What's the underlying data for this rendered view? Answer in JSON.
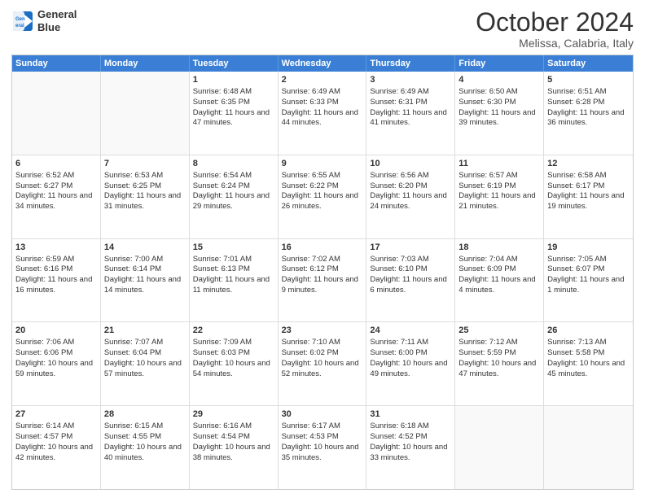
{
  "header": {
    "logo_line1": "General",
    "logo_line2": "Blue",
    "month": "October 2024",
    "location": "Melissa, Calabria, Italy"
  },
  "weekdays": [
    "Sunday",
    "Monday",
    "Tuesday",
    "Wednesday",
    "Thursday",
    "Friday",
    "Saturday"
  ],
  "rows": [
    [
      {
        "day": "",
        "content": ""
      },
      {
        "day": "",
        "content": ""
      },
      {
        "day": "1",
        "content": "Sunrise: 6:48 AM\nSunset: 6:35 PM\nDaylight: 11 hours and 47 minutes."
      },
      {
        "day": "2",
        "content": "Sunrise: 6:49 AM\nSunset: 6:33 PM\nDaylight: 11 hours and 44 minutes."
      },
      {
        "day": "3",
        "content": "Sunrise: 6:49 AM\nSunset: 6:31 PM\nDaylight: 11 hours and 41 minutes."
      },
      {
        "day": "4",
        "content": "Sunrise: 6:50 AM\nSunset: 6:30 PM\nDaylight: 11 hours and 39 minutes."
      },
      {
        "day": "5",
        "content": "Sunrise: 6:51 AM\nSunset: 6:28 PM\nDaylight: 11 hours and 36 minutes."
      }
    ],
    [
      {
        "day": "6",
        "content": "Sunrise: 6:52 AM\nSunset: 6:27 PM\nDaylight: 11 hours and 34 minutes."
      },
      {
        "day": "7",
        "content": "Sunrise: 6:53 AM\nSunset: 6:25 PM\nDaylight: 11 hours and 31 minutes."
      },
      {
        "day": "8",
        "content": "Sunrise: 6:54 AM\nSunset: 6:24 PM\nDaylight: 11 hours and 29 minutes."
      },
      {
        "day": "9",
        "content": "Sunrise: 6:55 AM\nSunset: 6:22 PM\nDaylight: 11 hours and 26 minutes."
      },
      {
        "day": "10",
        "content": "Sunrise: 6:56 AM\nSunset: 6:20 PM\nDaylight: 11 hours and 24 minutes."
      },
      {
        "day": "11",
        "content": "Sunrise: 6:57 AM\nSunset: 6:19 PM\nDaylight: 11 hours and 21 minutes."
      },
      {
        "day": "12",
        "content": "Sunrise: 6:58 AM\nSunset: 6:17 PM\nDaylight: 11 hours and 19 minutes."
      }
    ],
    [
      {
        "day": "13",
        "content": "Sunrise: 6:59 AM\nSunset: 6:16 PM\nDaylight: 11 hours and 16 minutes."
      },
      {
        "day": "14",
        "content": "Sunrise: 7:00 AM\nSunset: 6:14 PM\nDaylight: 11 hours and 14 minutes."
      },
      {
        "day": "15",
        "content": "Sunrise: 7:01 AM\nSunset: 6:13 PM\nDaylight: 11 hours and 11 minutes."
      },
      {
        "day": "16",
        "content": "Sunrise: 7:02 AM\nSunset: 6:12 PM\nDaylight: 11 hours and 9 minutes."
      },
      {
        "day": "17",
        "content": "Sunrise: 7:03 AM\nSunset: 6:10 PM\nDaylight: 11 hours and 6 minutes."
      },
      {
        "day": "18",
        "content": "Sunrise: 7:04 AM\nSunset: 6:09 PM\nDaylight: 11 hours and 4 minutes."
      },
      {
        "day": "19",
        "content": "Sunrise: 7:05 AM\nSunset: 6:07 PM\nDaylight: 11 hours and 1 minute."
      }
    ],
    [
      {
        "day": "20",
        "content": "Sunrise: 7:06 AM\nSunset: 6:06 PM\nDaylight: 10 hours and 59 minutes."
      },
      {
        "day": "21",
        "content": "Sunrise: 7:07 AM\nSunset: 6:04 PM\nDaylight: 10 hours and 57 minutes."
      },
      {
        "day": "22",
        "content": "Sunrise: 7:09 AM\nSunset: 6:03 PM\nDaylight: 10 hours and 54 minutes."
      },
      {
        "day": "23",
        "content": "Sunrise: 7:10 AM\nSunset: 6:02 PM\nDaylight: 10 hours and 52 minutes."
      },
      {
        "day": "24",
        "content": "Sunrise: 7:11 AM\nSunset: 6:00 PM\nDaylight: 10 hours and 49 minutes."
      },
      {
        "day": "25",
        "content": "Sunrise: 7:12 AM\nSunset: 5:59 PM\nDaylight: 10 hours and 47 minutes."
      },
      {
        "day": "26",
        "content": "Sunrise: 7:13 AM\nSunset: 5:58 PM\nDaylight: 10 hours and 45 minutes."
      }
    ],
    [
      {
        "day": "27",
        "content": "Sunrise: 6:14 AM\nSunset: 4:57 PM\nDaylight: 10 hours and 42 minutes."
      },
      {
        "day": "28",
        "content": "Sunrise: 6:15 AM\nSunset: 4:55 PM\nDaylight: 10 hours and 40 minutes."
      },
      {
        "day": "29",
        "content": "Sunrise: 6:16 AM\nSunset: 4:54 PM\nDaylight: 10 hours and 38 minutes."
      },
      {
        "day": "30",
        "content": "Sunrise: 6:17 AM\nSunset: 4:53 PM\nDaylight: 10 hours and 35 minutes."
      },
      {
        "day": "31",
        "content": "Sunrise: 6:18 AM\nSunset: 4:52 PM\nDaylight: 10 hours and 33 minutes."
      },
      {
        "day": "",
        "content": ""
      },
      {
        "day": "",
        "content": ""
      }
    ]
  ]
}
